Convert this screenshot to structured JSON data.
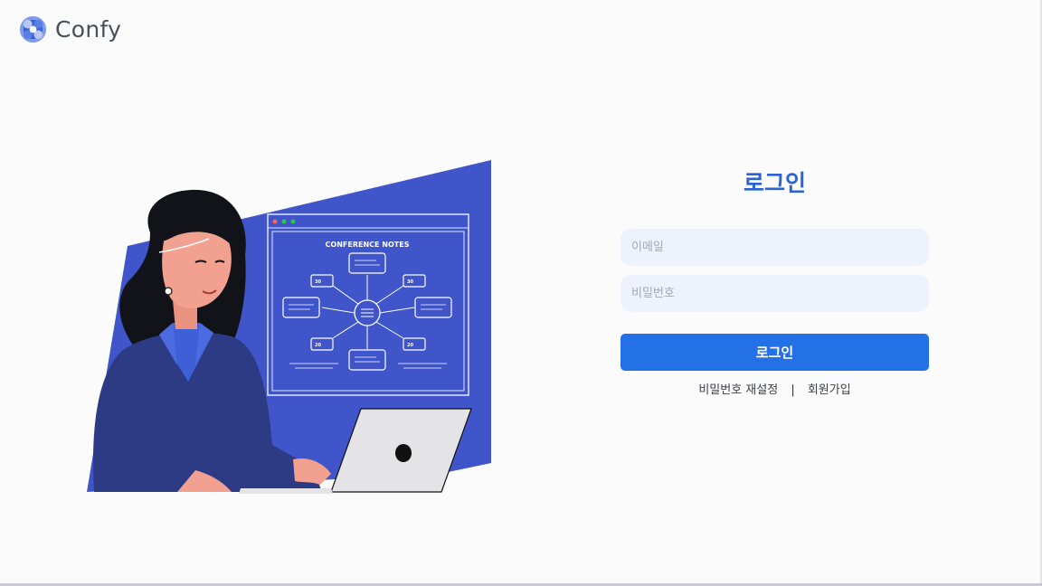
{
  "header": {
    "logo_text": "Confy",
    "logo_icon": "confy-logo-icon"
  },
  "illustration": {
    "board_title": "CONFERENCE NOTES",
    "badges": [
      "30",
      "30",
      "20",
      "20"
    ],
    "colors": {
      "primary_blue": "#3f55c9",
      "board_line": "#dfe5ff",
      "window_dots": [
        "#ff5f57",
        "#febc2e",
        "#28c840"
      ]
    }
  },
  "login": {
    "title": "로그인",
    "email_placeholder": "이메일",
    "password_placeholder": "비밀번호",
    "submit_label": "로그인",
    "reset_password_link": "비밀번호 재설정",
    "separator": "|",
    "signup_link": "회원가입"
  },
  "colors": {
    "accent": "#2470e6",
    "title": "#2a63d6",
    "input_bg": "#eef2fd"
  }
}
